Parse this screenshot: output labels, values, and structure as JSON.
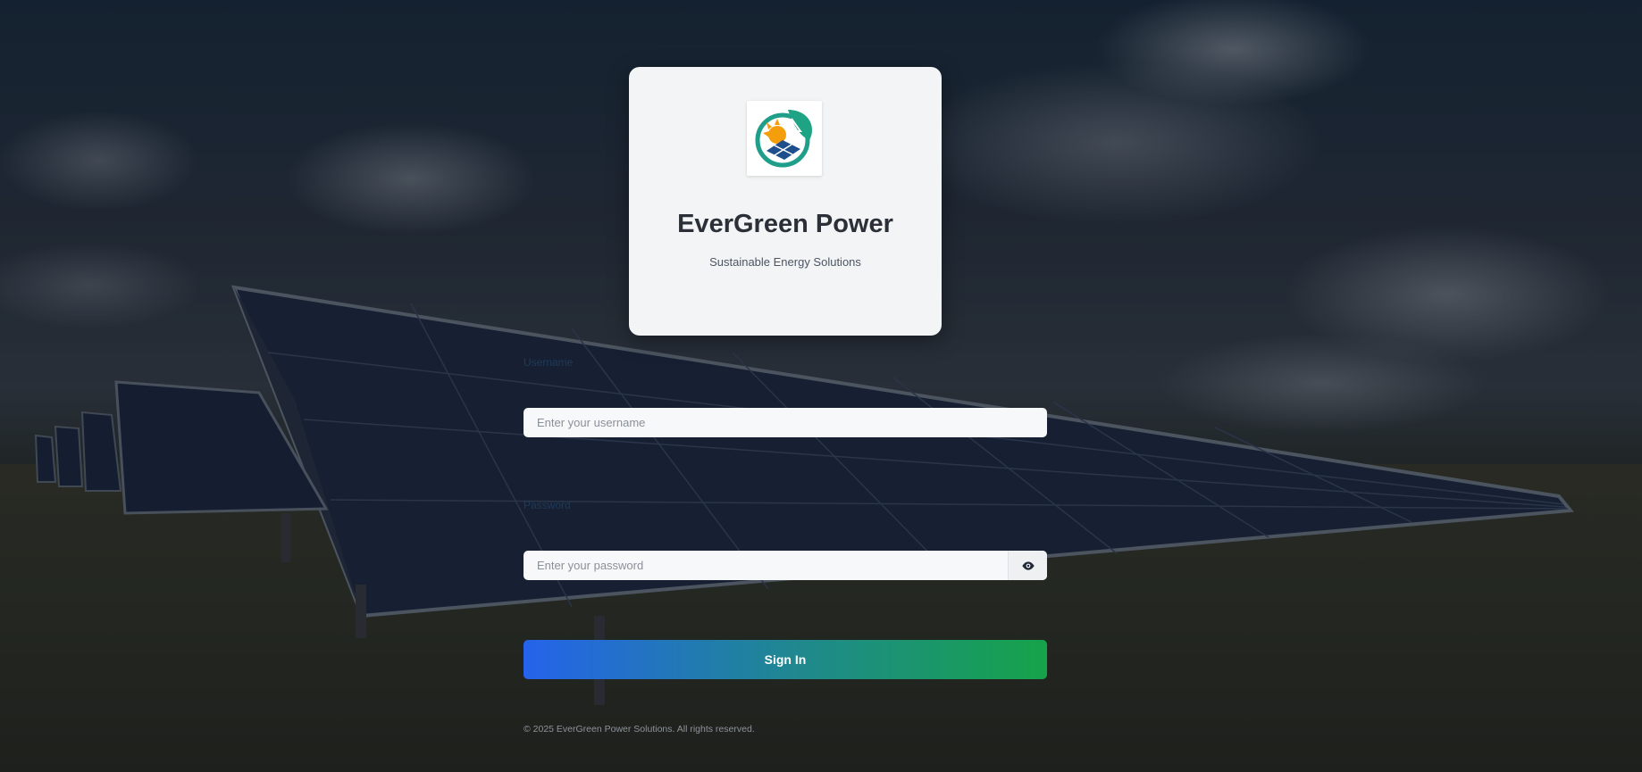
{
  "brand": {
    "title": "EverGreen Power",
    "subtitle": "Sustainable Energy Solutions",
    "logo_icon": "solar-leaf-logo"
  },
  "form": {
    "username_label": "Username",
    "username_placeholder": "Enter your username",
    "password_label": "Password",
    "password_placeholder": "Enter your password",
    "toggle_icon": "eye-icon",
    "submit_label": "Sign In"
  },
  "footer": {
    "copyright": "© 2025 EverGreen Power Solutions. All rights reserved."
  },
  "colors": {
    "button_gradient_start": "#2563eb",
    "button_gradient_end": "#16a34a",
    "card_background": "#f3f4f5"
  }
}
